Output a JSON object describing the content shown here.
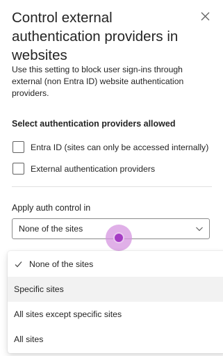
{
  "panel": {
    "title": "Control external authentication providers in websites",
    "description": "Use this setting to block user sign-ins through external (non Entra ID) website authentication providers."
  },
  "providers": {
    "label": "Select authentication providers allowed",
    "options": [
      {
        "label": "Entra ID (sites can only be accessed internally)",
        "checked": false
      },
      {
        "label": "External authentication providers",
        "checked": false
      }
    ]
  },
  "auth_control": {
    "label": "Apply auth control in",
    "selected": "None of the sites",
    "options": [
      {
        "label": "None of the sites",
        "selected": true
      },
      {
        "label": "Specific sites",
        "selected": false,
        "highlighted": true
      },
      {
        "label": "All sites except specific sites",
        "selected": false
      },
      {
        "label": "All sites",
        "selected": false
      }
    ]
  },
  "icons": {
    "close": "close-icon",
    "chevron": "chevron-down-icon",
    "check": "checkmark-icon"
  },
  "colors": {
    "text": "#242424",
    "cursor_outer": "#d696e0",
    "cursor_inner": "#a53cc4",
    "hover_bg": "#f2f2f2"
  }
}
